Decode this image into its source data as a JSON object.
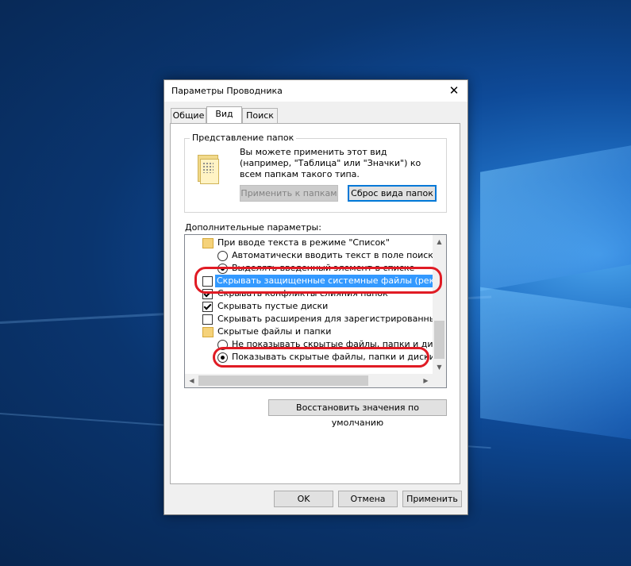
{
  "dialog": {
    "title": "Параметры Проводника",
    "close_glyph": "✕"
  },
  "tabs": [
    {
      "label": "Общие"
    },
    {
      "label": "Вид"
    },
    {
      "label": "Поиск"
    }
  ],
  "folder_views": {
    "group_label": "Представление папок",
    "description": "Вы можете применить этот вид (например, \"Таблица\" или \"Значки\") ко всем папкам такого типа.",
    "apply_button": "Применить к папкам",
    "reset_button": "Сброс вида папок"
  },
  "advanced": {
    "label": "Дополнительные параметры:",
    "items": [
      {
        "type": "folder",
        "label": "При вводе текста в режиме \"Список\""
      },
      {
        "type": "radio",
        "checked": false,
        "label": "Автоматически вводить текст в поле поиска"
      },
      {
        "type": "radio",
        "checked": true,
        "label": "Выделять введенный элемент в списке"
      },
      {
        "type": "checkbox",
        "checked": false,
        "selected": true,
        "label": "Скрывать защищенные системные файлы (рекомен"
      },
      {
        "type": "checkbox",
        "checked": true,
        "label": "Скрывать конфликты слияния папок"
      },
      {
        "type": "checkbox",
        "checked": true,
        "label": "Скрывать пустые диски"
      },
      {
        "type": "checkbox",
        "checked": false,
        "label": "Скрывать расширения для зарегистрированных типо"
      },
      {
        "type": "folder",
        "label": "Скрытые файлы и папки"
      },
      {
        "type": "radio",
        "checked": false,
        "label": "Не показывать скрытые файлы, папки и диски"
      },
      {
        "type": "radio",
        "checked": true,
        "label": "Показывать скрытые файлы, папки и диски"
      }
    ],
    "restore_button": "Восстановить значения по умолчанию"
  },
  "footer": {
    "ok": "OK",
    "cancel": "Отмена",
    "apply": "Применить"
  },
  "colors": {
    "selection": "#3399ff",
    "annotation": "#e01b24",
    "accent": "#0078d7"
  }
}
